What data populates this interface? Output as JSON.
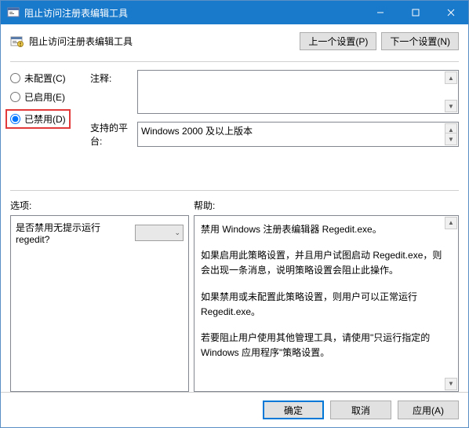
{
  "title": "阻止访问注册表编辑工具",
  "header": {
    "title": "阻止访问注册表编辑工具",
    "prev": "上一个设置(P)",
    "next": "下一个设置(N)"
  },
  "radios": {
    "notConfigured": "未配置(C)",
    "enabled": "已启用(E)",
    "disabled": "已禁用(D)"
  },
  "labels": {
    "comment": "注释:",
    "platform": "支持的平台:",
    "options": "选项:",
    "help": "帮助:"
  },
  "platform": "Windows 2000 及以上版本",
  "optionRow": "是否禁用无提示运行 regedit?",
  "help": {
    "p1": "禁用 Windows 注册表编辑器 Regedit.exe。",
    "p2": "如果启用此策略设置，并且用户试图启动 Regedit.exe，则会出现一条消息，说明策略设置会阻止此操作。",
    "p3": "如果禁用或未配置此策略设置，则用户可以正常运行 Regedit.exe。",
    "p4": "若要阻止用户使用其他管理工具，请使用\"只运行指定的 Windows 应用程序\"策略设置。"
  },
  "footer": {
    "ok": "确定",
    "cancel": "取消",
    "apply": "应用(A)"
  }
}
